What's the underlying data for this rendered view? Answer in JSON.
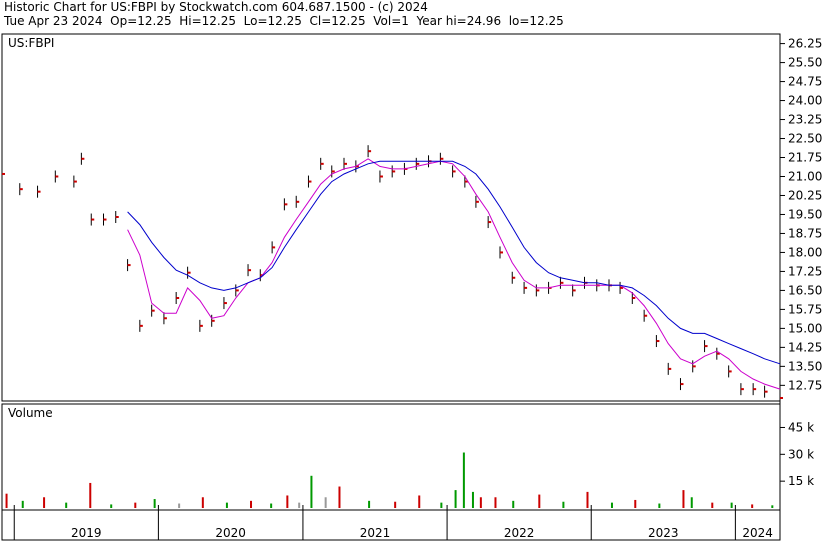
{
  "header": {
    "line1": "Historic Chart for US:FBPI by Stockwatch.com 604.687.1500 - (c) 2024",
    "line2": "Tue Apr 23 2024  Op=12.25  Hi=12.25  Lo=12.25  Cl=12.25  Vol=1  Year hi=24.96  lo=12.25"
  },
  "colors": {
    "ma_short": "#cc00cc",
    "ma_long": "#0000cc",
    "close_tick": "#cc0000",
    "vol_up": "#009900",
    "vol_down": "#cc0000",
    "vol_flat": "#999999"
  },
  "chart_data": [
    {
      "type": "line",
      "title": "US:FBPI",
      "y_ticks": [
        "26.25",
        "25.50",
        "24.75",
        "24.00",
        "23.25",
        "22.50",
        "21.75",
        "21.00",
        "20.25",
        "19.50",
        "18.75",
        "18.00",
        "17.25",
        "16.50",
        "15.75",
        "15.00",
        "14.25",
        "13.50",
        "12.75"
      ],
      "ylim": [
        12.25,
        26.55
      ],
      "x_ticks": [
        "2019",
        "2020",
        "2021",
        "2022",
        "2023",
        "2024"
      ],
      "x_range": [
        "2018-12-01",
        "2024-04-23"
      ],
      "series": [
        {
          "role": "price_close",
          "x": [
            "2018-12-01",
            "2019-01-15",
            "2019-03-01",
            "2019-04-15",
            "2019-06-01",
            "2019-06-20",
            "2019-07-15",
            "2019-08-15",
            "2019-09-15",
            "2019-10-15",
            "2019-11-15",
            "2019-12-15",
            "2020-01-15",
            "2020-02-15",
            "2020-03-15",
            "2020-04-15",
            "2020-05-15",
            "2020-06-15",
            "2020-07-15",
            "2020-08-15",
            "2020-09-15",
            "2020-10-15",
            "2020-11-15",
            "2020-12-15",
            "2021-01-15",
            "2021-02-15",
            "2021-03-15",
            "2021-04-15",
            "2021-05-15",
            "2021-06-15",
            "2021-07-15",
            "2021-08-15",
            "2021-09-15",
            "2021-10-15",
            "2021-11-15",
            "2021-12-15",
            "2022-01-15",
            "2022-02-15",
            "2022-03-15",
            "2022-04-15",
            "2022-05-15",
            "2022-06-15",
            "2022-07-15",
            "2022-08-15",
            "2022-09-15",
            "2022-10-15",
            "2022-11-15",
            "2022-12-15",
            "2023-01-15",
            "2023-02-15",
            "2023-03-15",
            "2023-04-15",
            "2023-05-15",
            "2023-06-15",
            "2023-07-15",
            "2023-08-15",
            "2023-09-15",
            "2023-10-15",
            "2023-11-15",
            "2023-12-15",
            "2024-01-15",
            "2024-02-15",
            "2024-03-15",
            "2024-04-23"
          ],
          "values": [
            21.1,
            20.5,
            20.4,
            21.0,
            20.8,
            21.7,
            19.3,
            19.3,
            19.4,
            17.5,
            15.1,
            15.7,
            15.4,
            16.2,
            17.2,
            15.1,
            15.3,
            16.0,
            16.5,
            17.3,
            17.1,
            18.2,
            19.9,
            20.0,
            20.8,
            21.5,
            21.2,
            21.5,
            21.4,
            22.0,
            21.0,
            21.2,
            21.3,
            21.5,
            21.6,
            21.7,
            21.2,
            20.8,
            20.0,
            19.2,
            18.0,
            17.0,
            16.6,
            16.5,
            16.6,
            16.8,
            16.5,
            16.8,
            16.7,
            16.7,
            16.6,
            16.2,
            15.5,
            14.5,
            13.4,
            12.8,
            13.5,
            14.3,
            14.0,
            13.3,
            12.6,
            12.6,
            12.5,
            12.25
          ]
        },
        {
          "role": "moving_average_short",
          "x": [
            "2018-12-01",
            "2019-01-15",
            "2019-03-01",
            "2019-04-15",
            "2019-06-01",
            "2019-06-20",
            "2019-07-15",
            "2019-08-15",
            "2019-09-15",
            "2019-10-15",
            "2019-11-15",
            "2019-12-15",
            "2020-01-15",
            "2020-02-15",
            "2020-03-15",
            "2020-04-15",
            "2020-05-15",
            "2020-06-15",
            "2020-07-15",
            "2020-08-15",
            "2020-09-15",
            "2020-10-15",
            "2020-11-15",
            "2020-12-15",
            "2021-01-15",
            "2021-02-15",
            "2021-03-15",
            "2021-04-15",
            "2021-05-15",
            "2021-06-15",
            "2021-07-15",
            "2021-08-15",
            "2021-09-15",
            "2021-10-15",
            "2021-11-15",
            "2021-12-15",
            "2022-01-15",
            "2022-02-15",
            "2022-03-15",
            "2022-04-15",
            "2022-05-15",
            "2022-06-15",
            "2022-07-15",
            "2022-08-15",
            "2022-09-15",
            "2022-10-15",
            "2022-11-15",
            "2022-12-15",
            "2023-01-15",
            "2023-02-15",
            "2023-03-15",
            "2023-04-15",
            "2023-05-15",
            "2023-06-15",
            "2023-07-15",
            "2023-08-15",
            "2023-09-15",
            "2023-10-15",
            "2023-11-15",
            "2023-12-15",
            "2024-01-15",
            "2024-02-15",
            "2024-03-15",
            "2024-04-23"
          ],
          "values": [
            null,
            null,
            null,
            null,
            null,
            null,
            null,
            null,
            null,
            18.9,
            17.9,
            16.0,
            15.6,
            15.6,
            16.6,
            16.1,
            15.4,
            15.5,
            16.2,
            16.8,
            17.0,
            17.6,
            18.6,
            19.3,
            20.0,
            20.7,
            21.1,
            21.3,
            21.4,
            21.7,
            21.4,
            21.3,
            21.3,
            21.4,
            21.5,
            21.6,
            21.5,
            21.0,
            20.3,
            19.6,
            18.6,
            17.6,
            16.9,
            16.6,
            16.6,
            16.7,
            16.7,
            16.7,
            16.7,
            16.7,
            16.7,
            16.4,
            15.9,
            15.2,
            14.4,
            13.8,
            13.6,
            13.9,
            14.1,
            13.8,
            13.3,
            13.0,
            12.8,
            12.6
          ]
        },
        {
          "role": "moving_average_long",
          "x": [
            "2019-10-15",
            "2019-11-15",
            "2019-12-15",
            "2020-01-15",
            "2020-02-15",
            "2020-03-15",
            "2020-04-15",
            "2020-05-15",
            "2020-06-15",
            "2020-07-15",
            "2020-08-15",
            "2020-09-15",
            "2020-10-15",
            "2020-11-15",
            "2020-12-15",
            "2021-01-15",
            "2021-02-15",
            "2021-03-15",
            "2021-04-15",
            "2021-05-15",
            "2021-06-15",
            "2021-07-15",
            "2021-08-15",
            "2021-09-15",
            "2021-10-15",
            "2021-11-15",
            "2021-12-15",
            "2022-01-15",
            "2022-02-15",
            "2022-03-15",
            "2022-04-15",
            "2022-05-15",
            "2022-06-15",
            "2022-07-15",
            "2022-08-15",
            "2022-09-15",
            "2022-10-15",
            "2022-11-15",
            "2022-12-15",
            "2023-01-15",
            "2023-02-15",
            "2023-03-15",
            "2023-04-15",
            "2023-05-15",
            "2023-06-15",
            "2023-07-15",
            "2023-08-15",
            "2023-09-15",
            "2023-10-15",
            "2023-11-15",
            "2023-12-15",
            "2024-01-15",
            "2024-02-15",
            "2024-03-15",
            "2024-04-23"
          ],
          "values": [
            19.6,
            19.1,
            18.4,
            17.8,
            17.3,
            17.1,
            16.8,
            16.6,
            16.5,
            16.6,
            16.8,
            17.0,
            17.4,
            18.2,
            18.9,
            19.6,
            20.3,
            20.8,
            21.1,
            21.3,
            21.5,
            21.6,
            21.6,
            21.6,
            21.6,
            21.6,
            21.6,
            21.6,
            21.4,
            21.1,
            20.5,
            19.8,
            19.0,
            18.2,
            17.6,
            17.2,
            17.0,
            16.9,
            16.8,
            16.8,
            16.7,
            16.7,
            16.6,
            16.3,
            15.9,
            15.4,
            15.0,
            14.8,
            14.8,
            14.6,
            14.4,
            14.2,
            14.0,
            13.8,
            13.6
          ]
        }
      ]
    },
    {
      "type": "bar",
      "title": "Volume",
      "y_ticks": [
        "45 k",
        "30 k",
        "15 k"
      ],
      "ylim": [
        0,
        57000
      ],
      "x_range": [
        "2018-12-01",
        "2024-04-23"
      ],
      "x": [
        "2018-12-10",
        "2019-01-20",
        "2019-03-15",
        "2019-05-10",
        "2019-07-10",
        "2019-09-01",
        "2019-11-01",
        "2019-12-20",
        "2020-02-20",
        "2020-04-20",
        "2020-06-20",
        "2020-08-20",
        "2020-10-10",
        "2020-11-20",
        "2020-12-20",
        "2021-01-20",
        "2021-02-25",
        "2021-04-01",
        "2021-06-15",
        "2021-08-20",
        "2021-10-20",
        "2021-12-15",
        "2022-01-20",
        "2022-02-10",
        "2022-03-05",
        "2022-03-25",
        "2022-05-01",
        "2022-06-15",
        "2022-08-20",
        "2022-10-20",
        "2022-12-20",
        "2023-02-20",
        "2023-04-20",
        "2023-06-20",
        "2023-08-20",
        "2023-09-10",
        "2023-11-01",
        "2023-12-20",
        "2024-02-10",
        "2024-04-01"
      ],
      "values": [
        8000,
        4000,
        6000,
        3000,
        14000,
        2000,
        3000,
        5000,
        2500,
        6000,
        3000,
        4000,
        2500,
        7000,
        3000,
        18000,
        6000,
        12000,
        4000,
        3500,
        7000,
        3000,
        10000,
        31000,
        9000,
        6000,
        6000,
        4000,
        7500,
        3500,
        9000,
        3000,
        4500,
        2500,
        10000,
        6000,
        3000,
        3000,
        2000,
        1500
      ],
      "colors": [
        "vol_down",
        "vol_up",
        "vol_down",
        "vol_up",
        "vol_down",
        "vol_up",
        "vol_down",
        "vol_up",
        "vol_flat",
        "vol_down",
        "vol_up",
        "vol_down",
        "vol_up",
        "vol_down",
        "vol_flat",
        "vol_up",
        "vol_flat",
        "vol_down",
        "vol_up",
        "vol_down",
        "vol_down",
        "vol_up",
        "vol_up",
        "vol_up",
        "vol_up",
        "vol_down",
        "vol_down",
        "vol_up",
        "vol_down",
        "vol_up",
        "vol_down",
        "vol_up",
        "vol_down",
        "vol_up",
        "vol_down",
        "vol_up",
        "vol_down",
        "vol_up",
        "vol_down",
        "vol_up"
      ]
    }
  ]
}
